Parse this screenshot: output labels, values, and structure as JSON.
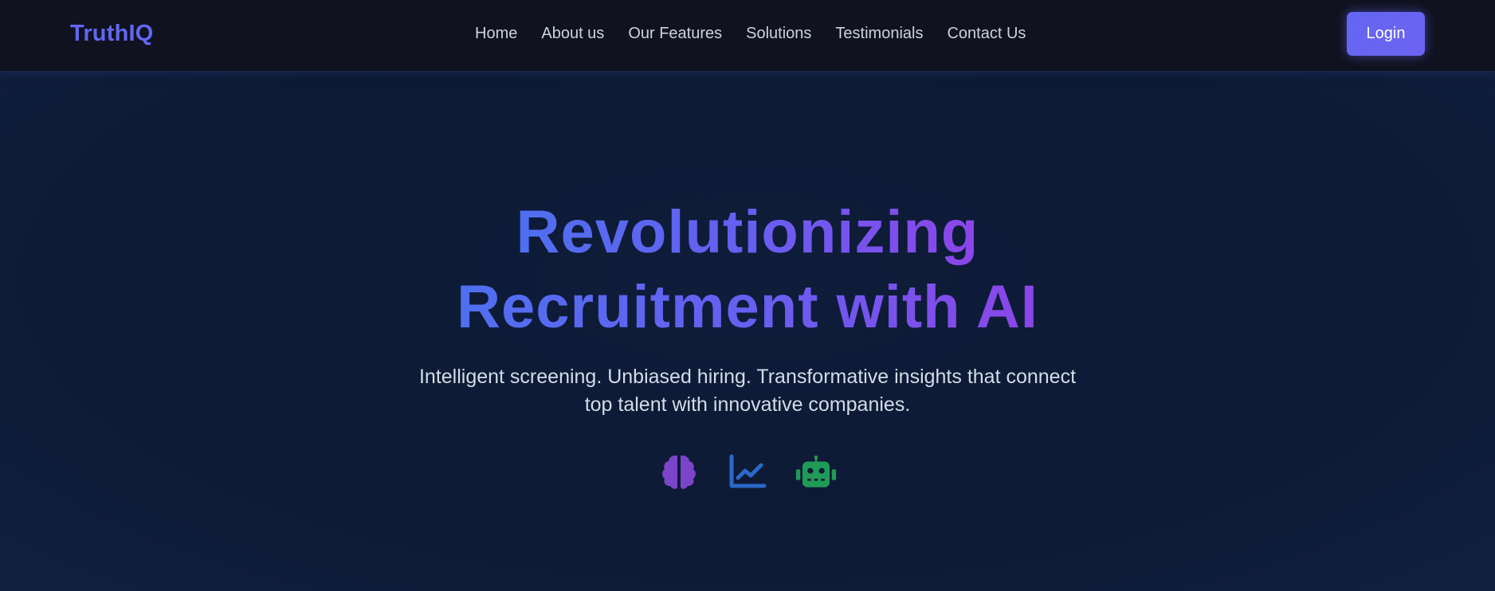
{
  "brand": {
    "name": "TruthIQ",
    "color": "#6366f1"
  },
  "nav": {
    "links": [
      "Home",
      "About us",
      "Our Features",
      "Solutions",
      "Testimonials",
      "Contact Us"
    ],
    "login_label": "Login"
  },
  "hero": {
    "title_line1": "Revolutionizing",
    "title_line2": "Recruitment with AI",
    "subtitle_line1": "Intelligent screening. Unbiased hiring. Transformative insights that connect",
    "subtitle_line2": "top talent with innovative companies.",
    "icons": [
      {
        "name": "brain-icon",
        "color": "#7b45c9"
      },
      {
        "name": "chart-line-icon",
        "color": "#2b68c9"
      },
      {
        "name": "robot-icon",
        "color": "#1f9a58"
      }
    ]
  },
  "colors": {
    "background": "#0f1a33",
    "navbar": "#10121f",
    "accent": "#6366f1",
    "gradient_start": "#4f6ff0",
    "gradient_end": "#8b45e8"
  }
}
